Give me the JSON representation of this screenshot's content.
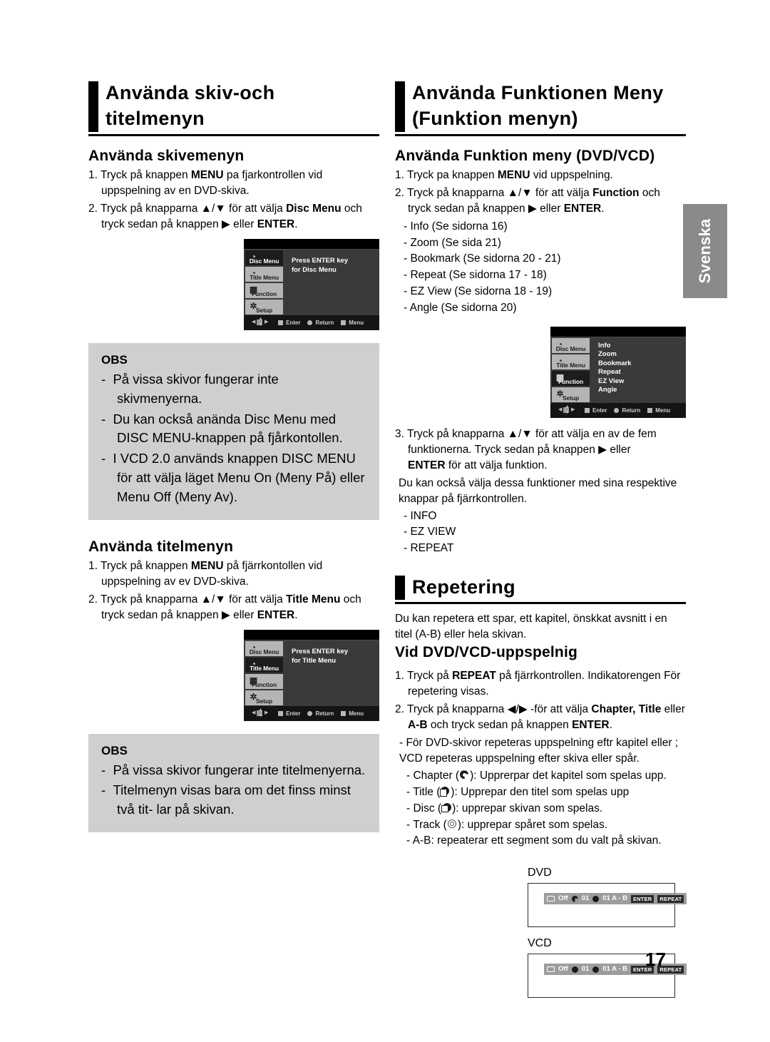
{
  "page": {
    "number": "17",
    "language_tab": "Svenska"
  },
  "left_column": {
    "section_title": "Använda skiv-och titelmenyn",
    "disc_menu": {
      "sub_head": "Använda skivemenyn",
      "step1": "1. Tryck på knappen MENU pa fjarkontrollen vid uppspelning av en DVD-skiva.",
      "step1_html": "1. Tryck på knappen <b>MENU</b> pa fjarkontrollen vid uppspelning av en DVD-skiva.",
      "step2_html": "2. Tryck på knapparna ▲/▼ för att välja <b>Disc Menu</b> och tryck sedan på knappen ▶ eller <b>ENTER</b>."
    },
    "osd_disc": {
      "items": [
        "Disc Menu",
        "Title Menu",
        "Function",
        "Setup"
      ],
      "selected": "Disc Menu",
      "body_lines": [
        "Press ENTER key",
        "for Disc Menu"
      ],
      "footer": [
        "Enter",
        "Return",
        "Menu"
      ]
    },
    "obs_disc": {
      "title": "OBS",
      "items": [
        "På vissa skivor fungerar inte skivmenyerna.",
        "Du kan också anända Disc Menu med DISC MENU-knappen på fjårkontollen.",
        "I VCD 2.0 används knappen DISC MENU för att välja läget Menu On (Meny På) eller Menu Off (Meny Av)."
      ]
    },
    "title_menu": {
      "sub_head": "Använda titelmenyn",
      "step1_html": "1. Tryck på knappen <b>MENU</b> på fjärrkontollen vid uppspelning av ev DVD-skiva.",
      "step2_html": "2. Tryck på knapparna ▲/▼ för att välja <b>Title Menu</b> och tryck sedan på knappen ▶ eller <b>ENTER</b>."
    },
    "osd_title": {
      "items": [
        "Disc Menu",
        "Title Menu",
        "Function",
        "Setup"
      ],
      "selected": "Title Menu",
      "body_lines": [
        "Press ENTER key",
        "for Title Menu"
      ],
      "footer": [
        "Enter",
        "Return",
        "Menu"
      ]
    },
    "obs_title": {
      "title": "OBS",
      "items": [
        "På vissa skivor fungerar inte titelmenyerna.",
        "Titelmenyn visas bara om det finss minst två tit- lar på skivan."
      ]
    }
  },
  "right_column": {
    "section_title": "Använda Funktionen Meny (Funktion menyn)",
    "function_menu": {
      "sub_head": "Använda Funktion meny (DVD/VCD)",
      "step1_html": "1. Tryck pa knappen <b>MENU</b> vid uppspelning.",
      "step2_html": "2. Tryck på knapparna ▲/▼ för att välja <b>Function</b> och tryck sedan på knappen ▶ eller <b>ENTER</b>.",
      "options": [
        "- Info (Se sidorna 16)",
        "- Zoom (Se sida 21)",
        "- Bookmark (Se sidorna 20 - 21)",
        "- Repeat (Se sidorna 17 - 18)",
        "- EZ View (Se sidorna 18 - 19)",
        "- Angle  (Se sidorna 20)"
      ]
    },
    "osd_function": {
      "items": [
        "Disc Menu",
        "Title Menu",
        "Function",
        "Setup"
      ],
      "selected": "Function",
      "body_lines": [
        "Info",
        "Zoom",
        "Bookmark",
        "Repeat",
        "EZ View",
        "Angle"
      ],
      "footer": [
        "Enter",
        "Return",
        "Menu"
      ]
    },
    "step3_html": "3. Tryck på knapparna ▲/▼ för att välja en av de fem funktionerna. Tryck sedan på knappen ▶ eller <br><b>ENTER</b> för att välja funktion.",
    "step3_extra": "Du kan också välja dessa funktioner med sina respektive knappar på fjärrkontrollen.",
    "remote_buttons": [
      "- INFO",
      "- EZ VIEW",
      "- REPEAT"
    ],
    "repeat": {
      "section_title": "Repetering",
      "intro": "Du kan repetera ett spar, ett kapitel, önskkat avsnitt i en titel (A-B) eller hela skivan.",
      "sub_head": "Vid DVD/VCD-uppspelnig",
      "step1_html": "1. Tryck på <b>REPEAT</b> på fjärrkontrollen. Indikatorengen För repetering visas.",
      "step2_html": "2. Tryck på knapparna ◀/▶ -för att välja <b>Chapter, Title</b> eller <b>A-B</b> och tryck sedan på knappen <b>ENTER</b>.",
      "note": "- För DVD-skivor repeteras uppspelning eftr kapitel eller ; VCD repeteras uppspelning efter skiva eller spår.",
      "icon_list": [
        {
          "prefix": "- Chapter (",
          "icon": "chapter",
          "suffix": "): Upprerpar det kapitel som spelas upp."
        },
        {
          "prefix": "- Title (",
          "icon": "title",
          "suffix": "): Upprepar den titel som spelas upp"
        },
        {
          "prefix": "- Disc (",
          "icon": "disc",
          "suffix": "): upprepar skivan som spelas."
        },
        {
          "prefix": "- Track (",
          "icon": "track",
          "suffix": "): upprepar spåret som spelas."
        }
      ],
      "ab_line": "- A-B: repeaterar ett segment som du valt på skivan."
    },
    "status_bars": [
      {
        "label": "DVD",
        "off": "Off",
        "first_value": "01",
        "second_value": "01 A - B",
        "keys": [
          "ENTER",
          "REPEAT"
        ]
      },
      {
        "label": "VCD",
        "off": "Off",
        "first_value": "01",
        "second_value": "01 A - B",
        "keys": [
          "ENTER",
          "REPEAT"
        ]
      }
    ]
  },
  "colors": {
    "note_bg": "#cfcfcf",
    "tab_bg": "#8a8a8a",
    "osd_bg": "#3a3a3a",
    "osd_item_bg": "#b5b5b5",
    "osd_item_sel": "#1c1c1c"
  }
}
